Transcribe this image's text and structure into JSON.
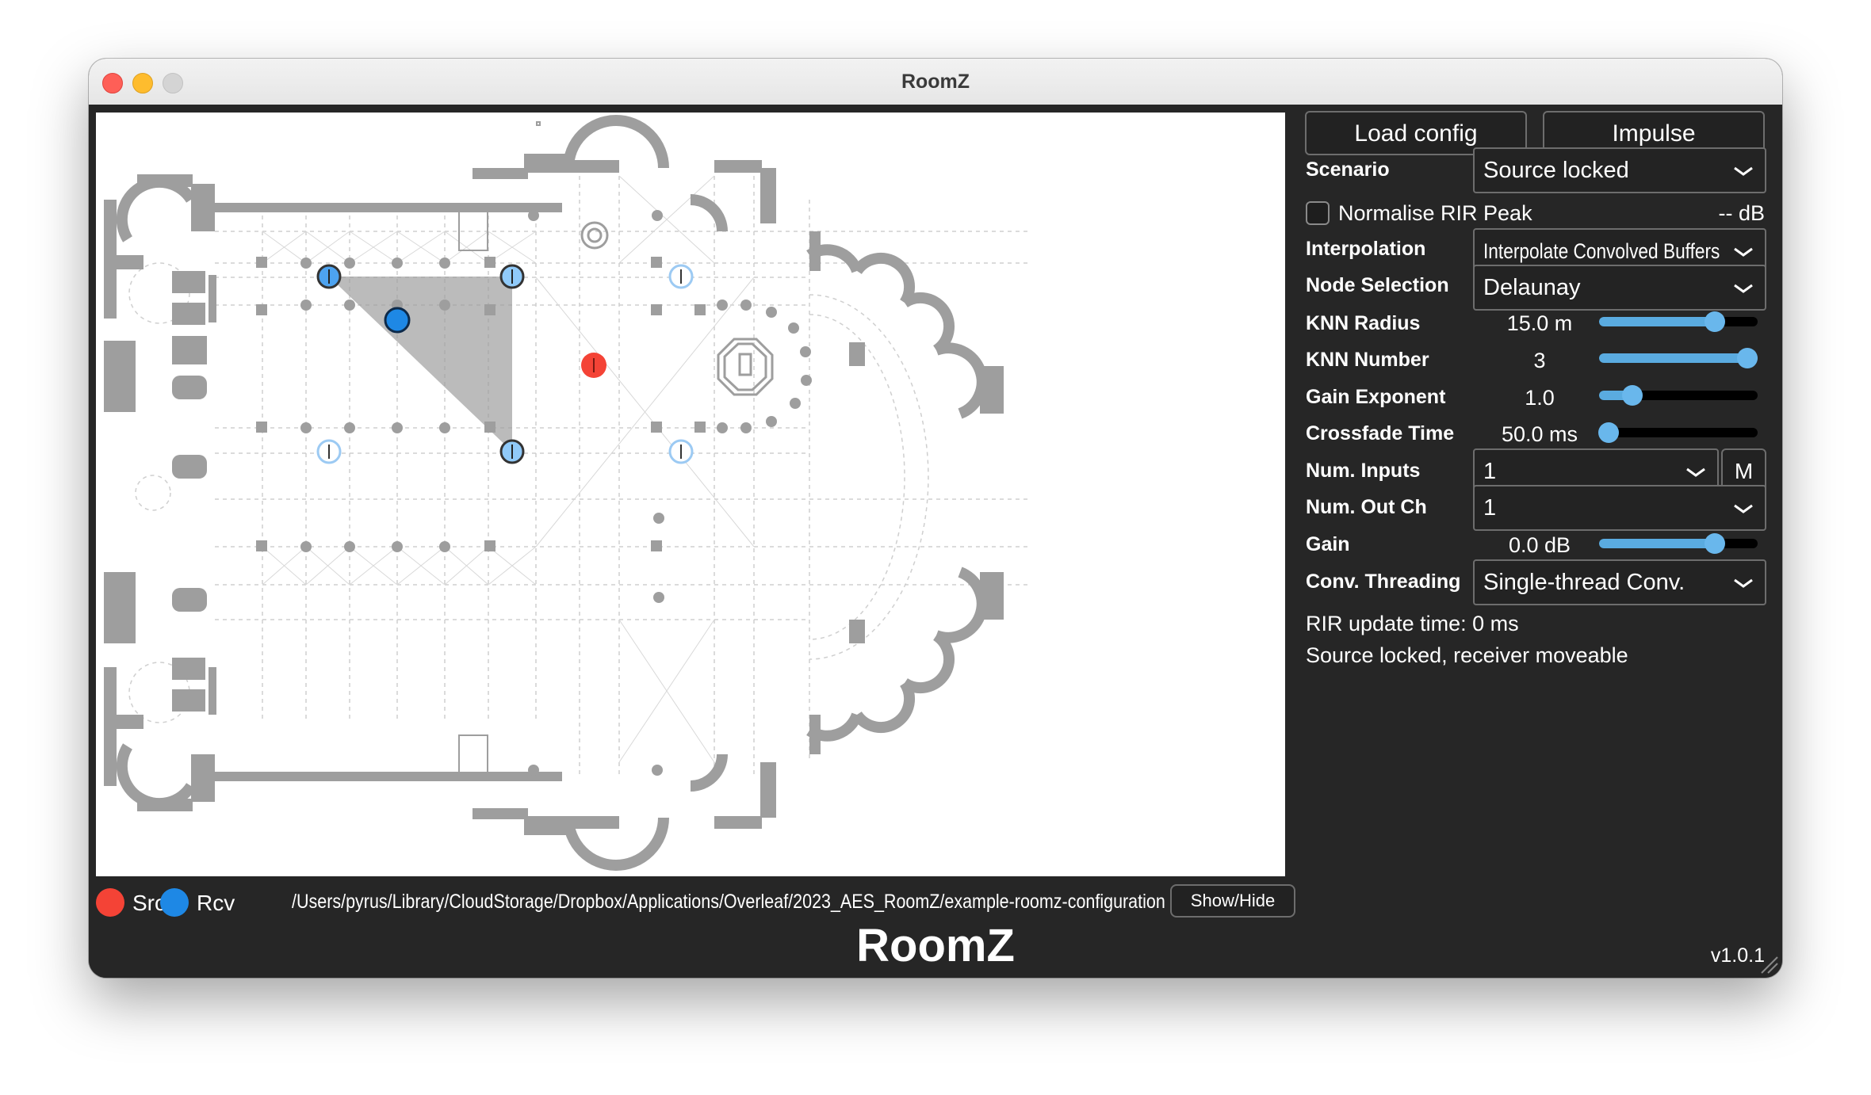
{
  "window": {
    "title": "RoomZ"
  },
  "map": {
    "legend": [
      {
        "label": "Src",
        "color": "#f44336"
      },
      {
        "label": "Rcv",
        "color": "#1e88e5"
      }
    ],
    "config_path": "/Users/pyrus/Library/CloudStorage/Dropbox/Applications/Overleaf/2023_AES_RoomZ/example-roomz-configuration",
    "show_hide_label": "Show/Hide",
    "source_color": "#f44336",
    "receiver_color": "#1e88e5",
    "active_node_color": "#90caf9",
    "inactive_node_color": "#bbdefb"
  },
  "panel": {
    "load_config_label": "Load config",
    "impulse_label": "Impulse",
    "scenario": {
      "label": "Scenario",
      "value": "Source locked"
    },
    "normalise": {
      "label": "Normalise RIR Peak",
      "checked": false,
      "readout": "-- dB"
    },
    "interpolation": {
      "label": "Interpolation",
      "value": "Interpolate Convolved Buffers"
    },
    "node_selection": {
      "label": "Node Selection",
      "value": "Delaunay"
    },
    "knn_radius": {
      "label": "KNN Radius",
      "value": "15.0 m",
      "level": 0.73
    },
    "knn_number": {
      "label": "KNN Number",
      "value": "3",
      "level": 1.0
    },
    "gain_exponent": {
      "label": "Gain Exponent",
      "value": "1.0",
      "level": 0.21
    },
    "crossfade_time": {
      "label": "Crossfade Time",
      "value": "50.0 ms",
      "level": 0.06
    },
    "num_inputs": {
      "label": "Num. Inputs",
      "value": "1",
      "m_label": "M"
    },
    "num_out_ch": {
      "label": "Num. Out Ch",
      "value": "1"
    },
    "gain": {
      "label": "Gain",
      "value": "0.0 dB",
      "level": 0.73
    },
    "conv_threading": {
      "label": "Conv. Threading",
      "value": "Single-thread Conv."
    },
    "rir_update": "RIR update time: 0 ms",
    "status": "Source locked, receiver moveable"
  },
  "footer": {
    "brand": "RoomZ",
    "version": "v1.0.1"
  },
  "icons": [
    "chevron-down-icon",
    "resize-grip-icon"
  ]
}
